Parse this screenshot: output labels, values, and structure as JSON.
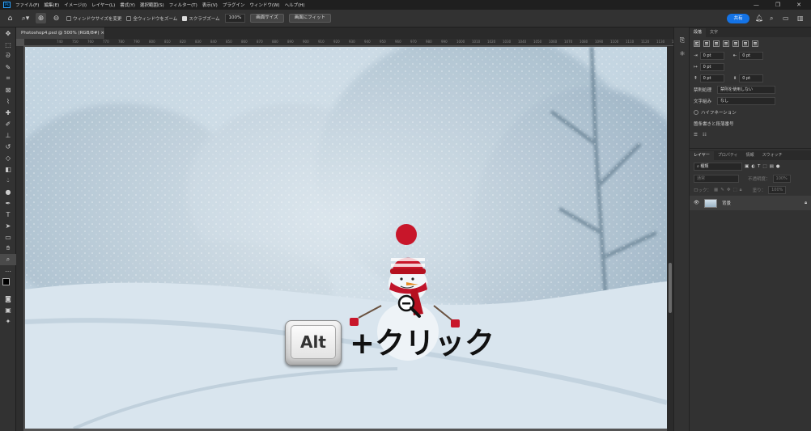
{
  "app": {
    "logo": "Ps"
  },
  "menu": [
    "ファイル(F)",
    "編集(E)",
    "イメージ(I)",
    "レイヤー(L)",
    "書式(Y)",
    "選択範囲(S)",
    "フィルター(T)",
    "表示(V)",
    "プラグイン",
    "ウィンドウ(W)",
    "ヘルプ(H)"
  ],
  "window_controls": [
    "—",
    "❐",
    "✕"
  ],
  "options": {
    "resize_windows": "ウィンドウサイズを変更",
    "zoom_all": "全ウィンドウをズーム",
    "scrubby_zoom": "スクラブズーム",
    "zoom_value": "100%",
    "fit_screen": "画面サイズ",
    "fill_screen": "画面にフィット",
    "share": "共有"
  },
  "document": {
    "tab_title": "Photoshop4.psd @ 500% (RGB/8#)",
    "close": "×"
  },
  "ruler_ticks": [
    "740",
    "750",
    "760",
    "770",
    "780",
    "790",
    "800",
    "810",
    "820",
    "830",
    "840",
    "850",
    "860",
    "870",
    "880",
    "890",
    "900",
    "910",
    "920",
    "930",
    "940",
    "950",
    "960",
    "970",
    "980",
    "990",
    "1000",
    "1010",
    "1020",
    "1030",
    "1040",
    "1050",
    "1060",
    "1070",
    "1080",
    "1090",
    "1100",
    "1110",
    "1120",
    "1130",
    "1140",
    "1150"
  ],
  "paragraph_panel": {
    "tabs": [
      "段落",
      "文字"
    ],
    "indent_left": "0 pt",
    "indent_right": "0 pt",
    "indent_first": "0 pt",
    "space_before": "0 pt",
    "space_after": "0 pt",
    "kinsoku_label": "禁則処理",
    "kinsoku_value": "禁則を使用しない",
    "mojikumi_label": "文字組み",
    "mojikumi_value": "なし",
    "hyphenation": "ハイフネーション",
    "list_label": "箇条書きと段落番号"
  },
  "layers_panel": {
    "tabs": [
      "レイヤー",
      "プロパティ",
      "情報",
      "スウォッチ"
    ],
    "filter_kind": "種類",
    "blend_mode": "通常",
    "opacity_label": "不透明度：",
    "opacity_value": "100%",
    "lock_label": "ロック：",
    "fill_label": "塗り：",
    "fill_value": "100%",
    "layers": [
      {
        "name": "背景"
      }
    ]
  },
  "overlay": {
    "key": "Alt",
    "text": "+クリック"
  },
  "colors": {
    "accent": "#1473e6",
    "panel": "#323232",
    "menubar": "#1f1f1f"
  }
}
